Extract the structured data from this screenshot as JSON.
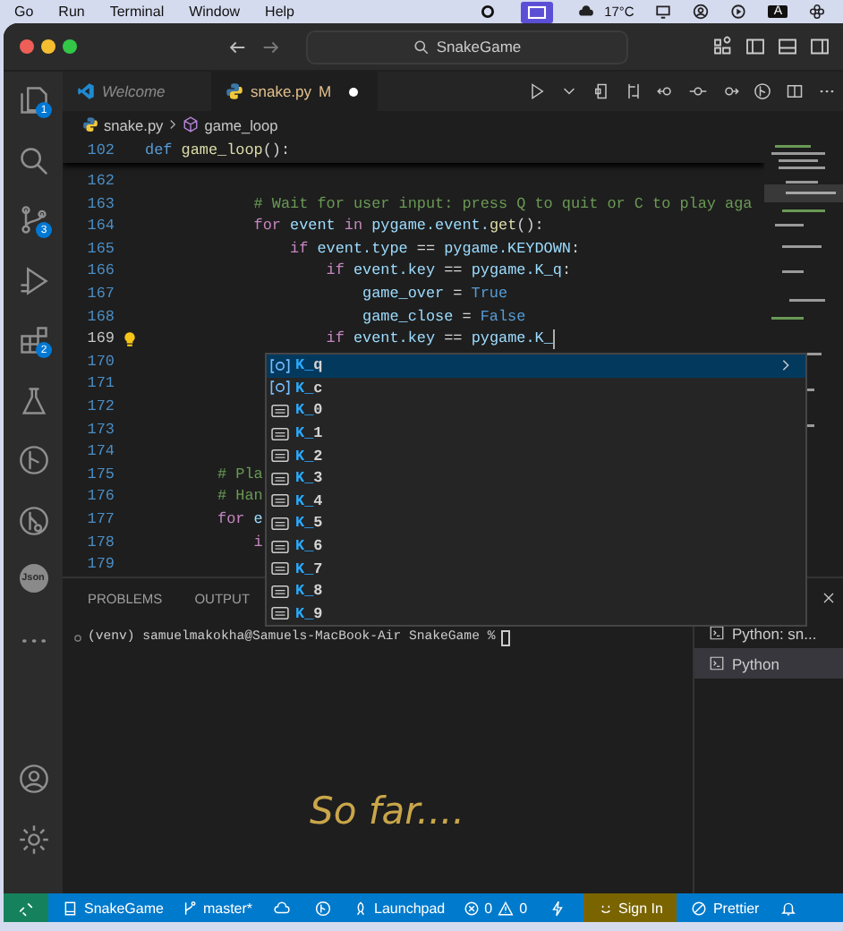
{
  "menu_bar": {
    "items": [
      "Go",
      "Run",
      "Terminal",
      "Window",
      "Help"
    ],
    "weather": "17°C",
    "input_source": "A"
  },
  "title_bar": {
    "search": "SnakeGame"
  },
  "activity_bar": [
    {
      "kind": "explorer",
      "badge": "1"
    },
    {
      "kind": "search"
    },
    {
      "kind": "scm",
      "badge": "3"
    },
    {
      "kind": "run"
    },
    {
      "kind": "extensions",
      "badge": "2"
    },
    {
      "kind": "testing"
    },
    {
      "kind": "graph"
    },
    {
      "kind": "remote"
    },
    {
      "kind": "json",
      "label": "Json"
    },
    {
      "kind": "more"
    }
  ],
  "activity_bottom": [
    {
      "kind": "account"
    },
    {
      "kind": "settings"
    }
  ],
  "tabs": [
    {
      "label": "Welcome",
      "kind": "welcome",
      "selected": false
    },
    {
      "label": "snake.py",
      "kind": "python",
      "badge": "M",
      "modified": true,
      "selected": true
    }
  ],
  "breadcrumb": [
    "snake.py",
    "game_loop"
  ],
  "sticky_line": {
    "number": "102",
    "tokens": [
      {
        "t": "def",
        "kind": "def"
      },
      {
        "t": " game_loop",
        "kind": "fn"
      },
      {
        "t": "():",
        "kind": "op"
      }
    ]
  },
  "code_lines": [
    {
      "number": "162",
      "current": false
    },
    {
      "number": "163",
      "current": false,
      "tokens": [
        {
          "t": "            # Wait for user input: press Q to quit or C to play aga",
          "kind": "cm"
        }
      ]
    },
    {
      "number": "164",
      "current": false,
      "tokens": [
        {
          "t": "            for",
          "kind": "kw"
        },
        {
          "t": " event ",
          "kind": "var"
        },
        {
          "t": "in",
          "kind": "kw"
        },
        {
          "t": " pygame.event.",
          "kind": "var"
        },
        {
          "t": "get",
          "kind": "fn"
        },
        {
          "t": "():",
          "kind": "op"
        }
      ]
    },
    {
      "number": "165",
      "current": false,
      "tokens": [
        {
          "t": "                if",
          "kind": "kw"
        },
        {
          "t": " event.type ",
          "kind": "var"
        },
        {
          "t": "== ",
          "kind": "op"
        },
        {
          "t": "pygame.KEYDOWN",
          "kind": "var"
        },
        {
          "t": ":",
          "kind": "op"
        }
      ]
    },
    {
      "number": "166",
      "current": false,
      "tokens": [
        {
          "t": "                    if",
          "kind": "kw"
        },
        {
          "t": " event.key ",
          "kind": "var"
        },
        {
          "t": "== ",
          "kind": "op"
        },
        {
          "t": "pygame.K_q",
          "kind": "var"
        },
        {
          "t": ":",
          "kind": "op"
        }
      ]
    },
    {
      "number": "167",
      "current": false,
      "tokens": [
        {
          "t": "                        game_over ",
          "kind": "var"
        },
        {
          "t": "= ",
          "kind": "op"
        },
        {
          "t": "True",
          "kind": "const"
        }
      ]
    },
    {
      "number": "168",
      "current": false,
      "tokens": [
        {
          "t": "                        game_close ",
          "kind": "var"
        },
        {
          "t": "= ",
          "kind": "op"
        },
        {
          "t": "False",
          "kind": "const"
        }
      ]
    },
    {
      "number": "169",
      "current": true,
      "lightbulb": true,
      "cursor": true,
      "tokens": [
        {
          "t": "                    if",
          "kind": "kw"
        },
        {
          "t": " event.key ",
          "kind": "var"
        },
        {
          "t": "== ",
          "kind": "op"
        },
        {
          "t": "pygame.K_",
          "kind": "var"
        }
      ]
    },
    {
      "number": "170",
      "current": false
    },
    {
      "number": "171",
      "current": false
    },
    {
      "number": "172",
      "current": false
    },
    {
      "number": "173",
      "current": false
    },
    {
      "number": "174",
      "current": false
    },
    {
      "number": "175",
      "current": false,
      "tokens": [
        {
          "t": "        # Pla",
          "kind": "cm"
        }
      ]
    },
    {
      "number": "176",
      "current": false,
      "tokens": [
        {
          "t": "        # Han",
          "kind": "cm"
        }
      ]
    },
    {
      "number": "177",
      "current": false,
      "tokens": [
        {
          "t": "        for",
          "kind": "kw"
        },
        {
          "t": " e",
          "kind": "var"
        }
      ]
    },
    {
      "number": "178",
      "current": false,
      "tokens": [
        {
          "t": "            i",
          "kind": "kw"
        }
      ]
    },
    {
      "number": "179",
      "current": false
    }
  ],
  "suggestions": [
    {
      "match": "K_",
      "rest": "q",
      "kind": "variable",
      "selected": true
    },
    {
      "match": "K_",
      "rest": "c",
      "kind": "variable",
      "selected": false
    },
    {
      "match": "K_",
      "rest": "0",
      "kind": "constant",
      "selected": false
    },
    {
      "match": "K_",
      "rest": "1",
      "kind": "constant",
      "selected": false
    },
    {
      "match": "K_",
      "rest": "2",
      "kind": "constant",
      "selected": false
    },
    {
      "match": "K_",
      "rest": "3",
      "kind": "constant",
      "selected": false
    },
    {
      "match": "K_",
      "rest": "4",
      "kind": "constant",
      "selected": false
    },
    {
      "match": "K_",
      "rest": "5",
      "kind": "constant",
      "selected": false
    },
    {
      "match": "K_",
      "rest": "6",
      "kind": "constant",
      "selected": false
    },
    {
      "match": "K_",
      "rest": "7",
      "kind": "constant",
      "selected": false
    },
    {
      "match": "K_",
      "rest": "8",
      "kind": "constant",
      "selected": false
    },
    {
      "match": "K_",
      "rest": "9",
      "kind": "constant",
      "selected": false
    }
  ],
  "panel_tabs": [
    "PROBLEMS",
    "OUTPUT"
  ],
  "terminal": {
    "prompt": "(venv) samuelmakokha@Samuels-MacBook-Air SnakeGame %"
  },
  "terminals": [
    {
      "label": "Python: sn...",
      "selected": false
    },
    {
      "label": "Python",
      "selected": true
    }
  ],
  "caption": "So far....",
  "status_bar": [
    {
      "kind": "remote"
    },
    {
      "kind": "repo",
      "label": "SnakeGame"
    },
    {
      "kind": "branch",
      "label": "master*"
    },
    {
      "kind": "cloud"
    },
    {
      "kind": "graph"
    },
    {
      "kind": "launchpad",
      "label": "Launchpad"
    },
    {
      "kind": "problems",
      "errors": "0",
      "warnings": "0"
    },
    {
      "kind": "bolt"
    },
    {
      "kind": "account",
      "label": "Sign In"
    },
    {
      "kind": "prettier",
      "label": "Prettier"
    },
    {
      "kind": "bell"
    }
  ]
}
